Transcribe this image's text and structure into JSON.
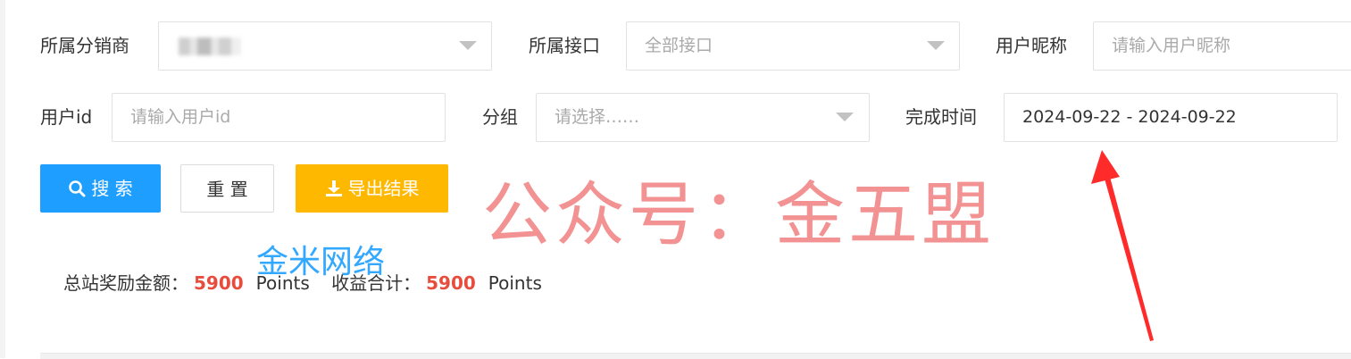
{
  "filters": {
    "distributor": {
      "label": "所属分销商",
      "value": ""
    },
    "api": {
      "label": "所属接口",
      "value": "全部接口"
    },
    "nickname": {
      "label": "用户昵称",
      "placeholder": "请输入用户昵称"
    },
    "user_id": {
      "label": "用户id",
      "placeholder": "请输入用户id"
    },
    "group": {
      "label": "分组",
      "placeholder": "请选择……"
    },
    "finish_time": {
      "label": "完成时间",
      "value": "2024-09-22 - 2024-09-22"
    }
  },
  "buttons": {
    "search": "搜 索",
    "reset": "重 置",
    "export": "导出结果"
  },
  "summary": {
    "total_reward_label": "总站奖励金额：",
    "total_reward_value": "5900",
    "unit1": "Points",
    "income_label": "收益合计：",
    "income_value": "5900",
    "unit2": "Points"
  },
  "watermarks": {
    "red": "公众号：金五盟",
    "blue": "金米网络"
  },
  "colors": {
    "primary": "#1e9fff",
    "warning": "#ffb800",
    "amount": "#e74c3c",
    "annotation_arrow": "#ff2a2a"
  }
}
